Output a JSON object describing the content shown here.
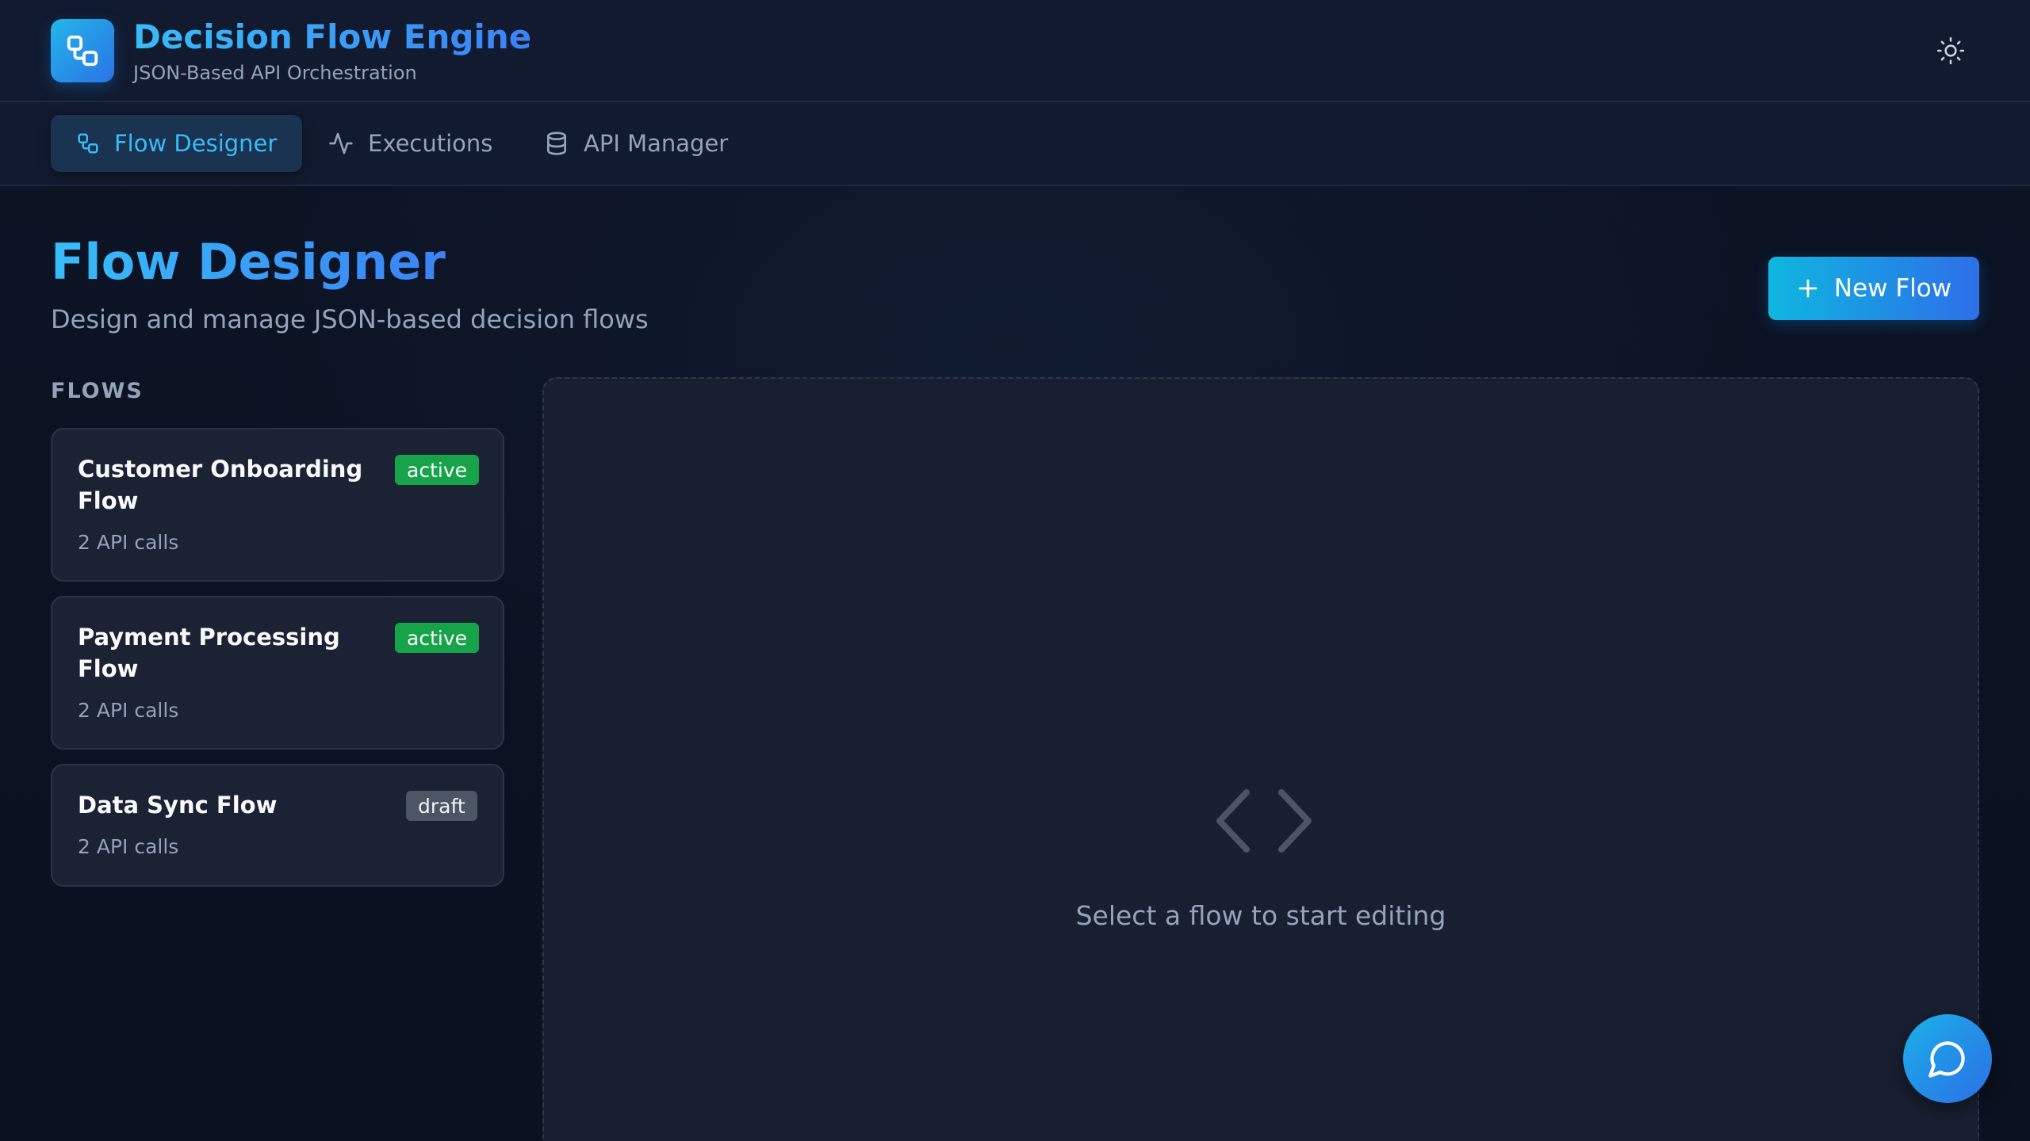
{
  "header": {
    "title": "Decision Flow Engine",
    "subtitle": "JSON-Based API Orchestration",
    "logo_icon": "workflow-icon",
    "theme_icon": "sun-icon"
  },
  "tabs": [
    {
      "label": "Flow Designer",
      "icon": "workflow-icon",
      "active": true
    },
    {
      "label": "Executions",
      "icon": "activity-icon",
      "active": false
    },
    {
      "label": "API Manager",
      "icon": "database-icon",
      "active": false
    }
  ],
  "page": {
    "title": "Flow Designer",
    "subtitle": "Design and manage JSON-based decision flows",
    "new_flow_label": "New Flow",
    "new_flow_icon": "plus-icon"
  },
  "flows": {
    "section_label": "FLOWS",
    "items": [
      {
        "name": "Customer Onboarding Flow",
        "calls": "2 API calls",
        "status": "active"
      },
      {
        "name": "Payment Processing Flow",
        "calls": "2 API calls",
        "status": "active"
      },
      {
        "name": "Data Sync Flow",
        "calls": "2 API calls",
        "status": "draft"
      }
    ]
  },
  "editor": {
    "empty_icon": "code-icon",
    "empty_text": "Select a flow to start editing"
  },
  "chat": {
    "icon": "message-circle-icon"
  },
  "colors": {
    "accent": "#38bdf8",
    "accent_blue": "#3b82f6",
    "active_badge": "#16a34a",
    "draft_badge": "#4b5563",
    "background": "#0b1222"
  }
}
